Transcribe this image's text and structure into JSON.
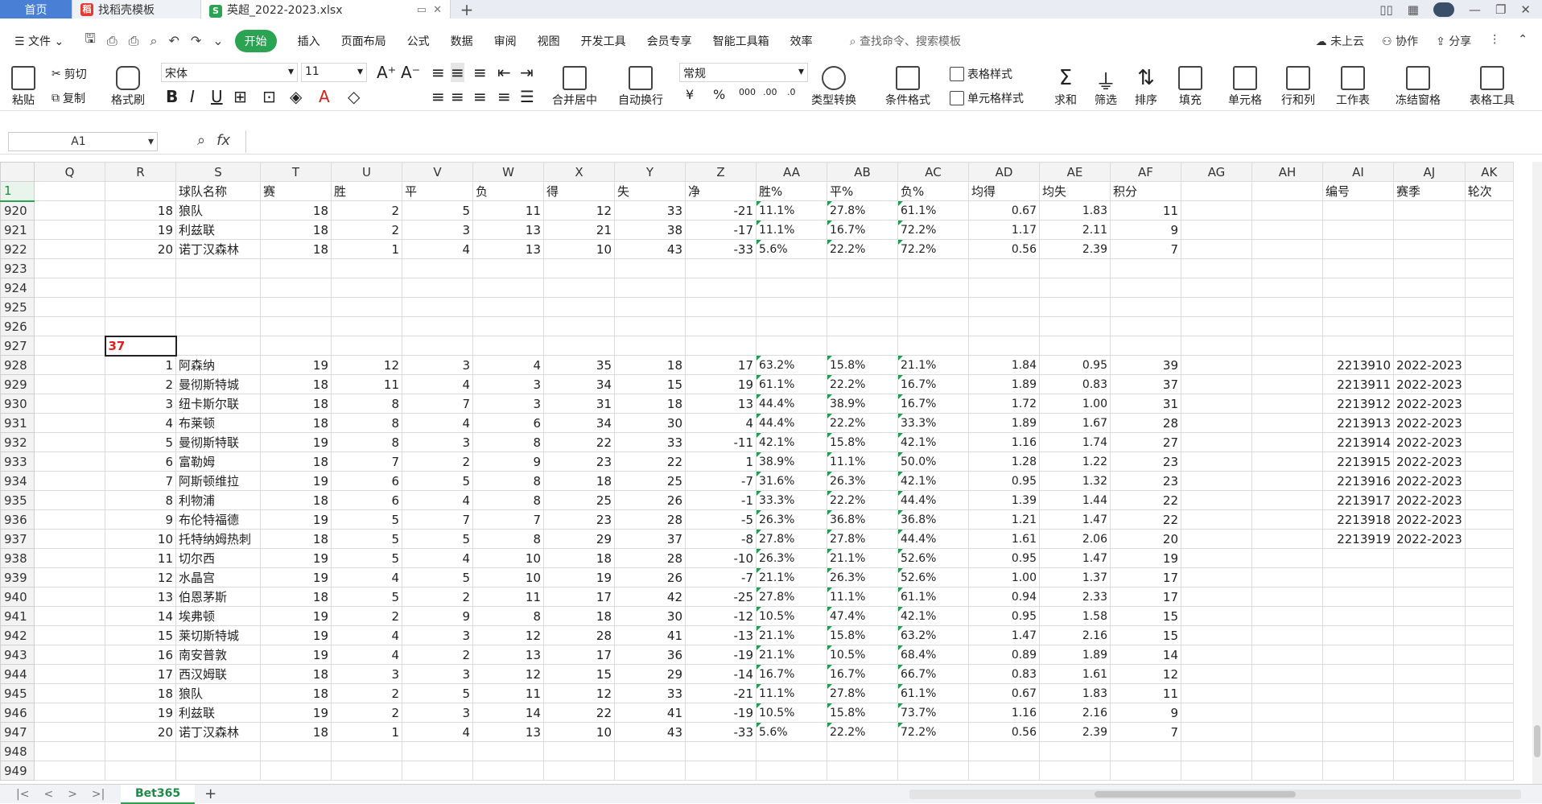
{
  "tabs": [
    {
      "label": "首页"
    },
    {
      "label": "找稻壳模板"
    },
    {
      "label": "英超_2022-2023.xlsx"
    }
  ],
  "menu": {
    "file": "文件",
    "start": "开始",
    "items": [
      "插入",
      "页面布局",
      "公式",
      "数据",
      "审阅",
      "视图",
      "开发工具",
      "会员专享",
      "智能工具箱",
      "效率"
    ],
    "search": "查找命令、搜索模板",
    "cloud": "未上云",
    "collab": "协作",
    "share": "分享"
  },
  "ribbon": {
    "paste": "粘贴",
    "cut": "剪切",
    "copy": "复制",
    "format_painter": "格式刷",
    "font": "宋体",
    "size": "11",
    "merge": "合并居中",
    "wrap": "自动换行",
    "number_format": "常规",
    "convert": "类型转换",
    "cond_format": "条件格式",
    "table_style": "表格样式",
    "cell_style": "单元格样式",
    "sum": "求和",
    "filter": "筛选",
    "sort": "排序",
    "fill": "填充",
    "cell": "单元格",
    "row_col": "行和列",
    "worksheet": "工作表",
    "freeze": "冻结窗格",
    "table_tools": "表格工具"
  },
  "formula_bar": {
    "name_box": "A1",
    "fx": "fx"
  },
  "columns": [
    "Q",
    "R",
    "S",
    "T",
    "U",
    "V",
    "W",
    "X",
    "Y",
    "Z",
    "AA",
    "AB",
    "AC",
    "AD",
    "AE",
    "AF",
    "AG",
    "AH",
    "AI",
    "AJ",
    "AK"
  ],
  "header_row": {
    "num": "1",
    "S": "球队名称",
    "T": "赛",
    "U": "胜",
    "V": "平",
    "W": "负",
    "X": "得",
    "Y": "失",
    "Z": "净",
    "AA": "胜%",
    "AB": "平%",
    "AC": "负%",
    "AD": "均得",
    "AE": "均失",
    "AF": "积分",
    "AI": "编号",
    "AJ": "赛季",
    "AK": "轮次"
  },
  "rows": [
    {
      "num": "920",
      "r": "18",
      "team": "狼队",
      "p": "18",
      "w": "2",
      "d": "5",
      "l": "11",
      "gf": "12",
      "ga": "33",
      "gd": "-21",
      "wp": "11.1%",
      "dp": "27.8%",
      "lp": "61.1%",
      "ag": "0.67",
      "al": "1.83",
      "pts": "11",
      "id": "",
      "season": ""
    },
    {
      "num": "921",
      "r": "19",
      "team": "利兹联",
      "p": "18",
      "w": "2",
      "d": "3",
      "l": "13",
      "gf": "21",
      "ga": "38",
      "gd": "-17",
      "wp": "11.1%",
      "dp": "16.7%",
      "lp": "72.2%",
      "ag": "1.17",
      "al": "2.11",
      "pts": "9",
      "id": "",
      "season": ""
    },
    {
      "num": "922",
      "r": "20",
      "team": "诺丁汉森林",
      "p": "18",
      "w": "1",
      "d": "4",
      "l": "13",
      "gf": "10",
      "ga": "43",
      "gd": "-33",
      "wp": "5.6%",
      "dp": "22.2%",
      "lp": "72.2%",
      "ag": "0.56",
      "al": "2.39",
      "pts": "7",
      "id": "",
      "season": ""
    },
    {
      "num": "923",
      "empty": true
    },
    {
      "num": "924",
      "empty": true
    },
    {
      "num": "925",
      "empty": true
    },
    {
      "num": "926",
      "empty": true
    },
    {
      "num": "927",
      "marker": "37"
    },
    {
      "num": "928",
      "r": "1",
      "team": "阿森纳",
      "p": "19",
      "w": "12",
      "d": "3",
      "l": "4",
      "gf": "35",
      "ga": "18",
      "gd": "17",
      "wp": "63.2%",
      "dp": "15.8%",
      "lp": "21.1%",
      "ag": "1.84",
      "al": "0.95",
      "pts": "39",
      "id": "2213910",
      "season": "2022-2023"
    },
    {
      "num": "929",
      "r": "2",
      "team": "曼彻斯特城",
      "p": "18",
      "w": "11",
      "d": "4",
      "l": "3",
      "gf": "34",
      "ga": "15",
      "gd": "19",
      "wp": "61.1%",
      "dp": "22.2%",
      "lp": "16.7%",
      "ag": "1.89",
      "al": "0.83",
      "pts": "37",
      "id": "2213911",
      "season": "2022-2023"
    },
    {
      "num": "930",
      "r": "3",
      "team": "纽卡斯尔联",
      "p": "18",
      "w": "8",
      "d": "7",
      "l": "3",
      "gf": "31",
      "ga": "18",
      "gd": "13",
      "wp": "44.4%",
      "dp": "38.9%",
      "lp": "16.7%",
      "ag": "1.72",
      "al": "1.00",
      "pts": "31",
      "id": "2213912",
      "season": "2022-2023"
    },
    {
      "num": "931",
      "r": "4",
      "team": "布莱顿",
      "p": "18",
      "w": "8",
      "d": "4",
      "l": "6",
      "gf": "34",
      "ga": "30",
      "gd": "4",
      "wp": "44.4%",
      "dp": "22.2%",
      "lp": "33.3%",
      "ag": "1.89",
      "al": "1.67",
      "pts": "28",
      "id": "2213913",
      "season": "2022-2023"
    },
    {
      "num": "932",
      "r": "5",
      "team": "曼彻斯特联",
      "p": "19",
      "w": "8",
      "d": "3",
      "l": "8",
      "gf": "22",
      "ga": "33",
      "gd": "-11",
      "wp": "42.1%",
      "dp": "15.8%",
      "lp": "42.1%",
      "ag": "1.16",
      "al": "1.74",
      "pts": "27",
      "id": "2213914",
      "season": "2022-2023"
    },
    {
      "num": "933",
      "r": "6",
      "team": "富勒姆",
      "p": "18",
      "w": "7",
      "d": "2",
      "l": "9",
      "gf": "23",
      "ga": "22",
      "gd": "1",
      "wp": "38.9%",
      "dp": "11.1%",
      "lp": "50.0%",
      "ag": "1.28",
      "al": "1.22",
      "pts": "23",
      "id": "2213915",
      "season": "2022-2023"
    },
    {
      "num": "934",
      "r": "7",
      "team": "阿斯顿维拉",
      "p": "19",
      "w": "6",
      "d": "5",
      "l": "8",
      "gf": "18",
      "ga": "25",
      "gd": "-7",
      "wp": "31.6%",
      "dp": "26.3%",
      "lp": "42.1%",
      "ag": "0.95",
      "al": "1.32",
      "pts": "23",
      "id": "2213916",
      "season": "2022-2023"
    },
    {
      "num": "935",
      "r": "8",
      "team": "利物浦",
      "p": "18",
      "w": "6",
      "d": "4",
      "l": "8",
      "gf": "25",
      "ga": "26",
      "gd": "-1",
      "wp": "33.3%",
      "dp": "22.2%",
      "lp": "44.4%",
      "ag": "1.39",
      "al": "1.44",
      "pts": "22",
      "id": "2213917",
      "season": "2022-2023"
    },
    {
      "num": "936",
      "r": "9",
      "team": "布伦特福德",
      "p": "19",
      "w": "5",
      "d": "7",
      "l": "7",
      "gf": "23",
      "ga": "28",
      "gd": "-5",
      "wp": "26.3%",
      "dp": "36.8%",
      "lp": "36.8%",
      "ag": "1.21",
      "al": "1.47",
      "pts": "22",
      "id": "2213918",
      "season": "2022-2023"
    },
    {
      "num": "937",
      "r": "10",
      "team": "托特纳姆热刺",
      "p": "18",
      "w": "5",
      "d": "5",
      "l": "8",
      "gf": "29",
      "ga": "37",
      "gd": "-8",
      "wp": "27.8%",
      "dp": "27.8%",
      "lp": "44.4%",
      "ag": "1.61",
      "al": "2.06",
      "pts": "20",
      "id": "2213919",
      "season": "2022-2023"
    },
    {
      "num": "938",
      "r": "11",
      "team": "切尔西",
      "p": "19",
      "w": "5",
      "d": "4",
      "l": "10",
      "gf": "18",
      "ga": "28",
      "gd": "-10",
      "wp": "26.3%",
      "dp": "21.1%",
      "lp": "52.6%",
      "ag": "0.95",
      "al": "1.47",
      "pts": "19",
      "id": "",
      "season": ""
    },
    {
      "num": "939",
      "r": "12",
      "team": "水晶宫",
      "p": "19",
      "w": "4",
      "d": "5",
      "l": "10",
      "gf": "19",
      "ga": "26",
      "gd": "-7",
      "wp": "21.1%",
      "dp": "26.3%",
      "lp": "52.6%",
      "ag": "1.00",
      "al": "1.37",
      "pts": "17",
      "id": "",
      "season": ""
    },
    {
      "num": "940",
      "r": "13",
      "team": "伯恩茅斯",
      "p": "18",
      "w": "5",
      "d": "2",
      "l": "11",
      "gf": "17",
      "ga": "42",
      "gd": "-25",
      "wp": "27.8%",
      "dp": "11.1%",
      "lp": "61.1%",
      "ag": "0.94",
      "al": "2.33",
      "pts": "17",
      "id": "",
      "season": ""
    },
    {
      "num": "941",
      "r": "14",
      "team": "埃弗顿",
      "p": "19",
      "w": "2",
      "d": "9",
      "l": "8",
      "gf": "18",
      "ga": "30",
      "gd": "-12",
      "wp": "10.5%",
      "dp": "47.4%",
      "lp": "42.1%",
      "ag": "0.95",
      "al": "1.58",
      "pts": "15",
      "id": "",
      "season": ""
    },
    {
      "num": "942",
      "r": "15",
      "team": "莱切斯特城",
      "p": "19",
      "w": "4",
      "d": "3",
      "l": "12",
      "gf": "28",
      "ga": "41",
      "gd": "-13",
      "wp": "21.1%",
      "dp": "15.8%",
      "lp": "63.2%",
      "ag": "1.47",
      "al": "2.16",
      "pts": "15",
      "id": "",
      "season": ""
    },
    {
      "num": "943",
      "r": "16",
      "team": "南安普敦",
      "p": "19",
      "w": "4",
      "d": "2",
      "l": "13",
      "gf": "17",
      "ga": "36",
      "gd": "-19",
      "wp": "21.1%",
      "dp": "10.5%",
      "lp": "68.4%",
      "ag": "0.89",
      "al": "1.89",
      "pts": "14",
      "id": "",
      "season": ""
    },
    {
      "num": "944",
      "r": "17",
      "team": "西汉姆联",
      "p": "18",
      "w": "3",
      "d": "3",
      "l": "12",
      "gf": "15",
      "ga": "29",
      "gd": "-14",
      "wp": "16.7%",
      "dp": "16.7%",
      "lp": "66.7%",
      "ag": "0.83",
      "al": "1.61",
      "pts": "12",
      "id": "",
      "season": ""
    },
    {
      "num": "945",
      "r": "18",
      "team": "狼队",
      "p": "18",
      "w": "2",
      "d": "5",
      "l": "11",
      "gf": "12",
      "ga": "33",
      "gd": "-21",
      "wp": "11.1%",
      "dp": "27.8%",
      "lp": "61.1%",
      "ag": "0.67",
      "al": "1.83",
      "pts": "11",
      "id": "",
      "season": ""
    },
    {
      "num": "946",
      "r": "19",
      "team": "利兹联",
      "p": "19",
      "w": "2",
      "d": "3",
      "l": "14",
      "gf": "22",
      "ga": "41",
      "gd": "-19",
      "wp": "10.5%",
      "dp": "15.8%",
      "lp": "73.7%",
      "ag": "1.16",
      "al": "2.16",
      "pts": "9",
      "id": "",
      "season": ""
    },
    {
      "num": "947",
      "r": "20",
      "team": "诺丁汉森林",
      "p": "18",
      "w": "1",
      "d": "4",
      "l": "13",
      "gf": "10",
      "ga": "43",
      "gd": "-33",
      "wp": "5.6%",
      "dp": "22.2%",
      "lp": "72.2%",
      "ag": "0.56",
      "al": "2.39",
      "pts": "7",
      "id": "",
      "season": ""
    },
    {
      "num": "948",
      "empty": true
    },
    {
      "num": "949",
      "empty": true
    }
  ],
  "sheet_tab": "Bet365",
  "colors": {
    "accent": "#2aa352",
    "marker": "#e02020",
    "home_tab": "#4a7fd6"
  }
}
